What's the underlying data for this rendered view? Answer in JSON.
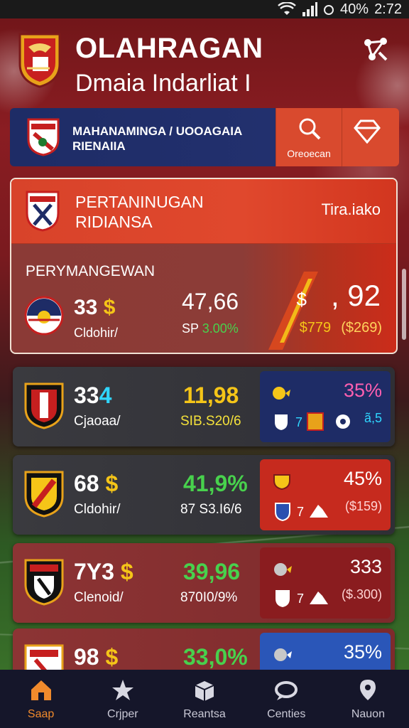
{
  "status_bar": {
    "battery": "40%",
    "time": "2:72"
  },
  "header": {
    "title": "OLAHRAGAN",
    "subtitle": "Dmaia Indarliat I"
  },
  "banner": {
    "line1": "MAHANAMINGA / UOOAGAIA",
    "line2": "RIENAIIA",
    "search_label": "Oreoecan"
  },
  "featured": {
    "title_line1": "PERTANINUGAN",
    "title_line2": "RIDIANSA",
    "tag": "Tira.iako",
    "section_label": "PERYMANGEWAN",
    "score": "33",
    "score_currency": "$",
    "label": "Cldohir/",
    "mid_value": "47,66",
    "mid_sub_prefix": "SP",
    "mid_sub_pct": "3.00%",
    "right_currency": "$",
    "right_value": ", 92",
    "right_sub_a": "$779",
    "right_sub_b": "($269)"
  },
  "cards": [
    {
      "score": "33",
      "score_suffix": "4",
      "label": "Cjaoaa/",
      "mid_value": "11,98",
      "mid_sub": "SIB.S20/6",
      "side_value": "35%",
      "side_num": "7",
      "side_sub": "ã,5"
    },
    {
      "score": "68",
      "score_currency": "$",
      "label": "Cldohir/",
      "mid_value": "41,9%",
      "mid_sub": "87 S3.I6/6",
      "side_value": "45%",
      "side_num": "7",
      "side_sub": "($159)"
    },
    {
      "score": "7Y3",
      "score_currency": "$",
      "label": "Clenoid/",
      "mid_value": "39,96",
      "mid_sub": "870I0/9%",
      "side_value": "333",
      "side_num": "7",
      "side_sub": "($.300)"
    },
    {
      "score": "98",
      "score_currency": "$",
      "label": "",
      "mid_value": "33,0%",
      "mid_sub": "",
      "side_value": "35%"
    }
  ],
  "colors": {
    "accent_orange": "#d94a2e",
    "navy": "#1e2c66",
    "gold": "#f5c518",
    "green": "#48d14d",
    "cyan": "#2fd6ff",
    "pink": "#ff5fb0",
    "nav_active": "#f08a2c"
  },
  "bottom_nav": [
    {
      "label": "Saap",
      "icon": "home-icon"
    },
    {
      "label": "Crjper",
      "icon": "star-icon"
    },
    {
      "label": "Reantsa",
      "icon": "box-icon"
    },
    {
      "label": "Centies",
      "icon": "chat-icon"
    },
    {
      "label": "Nauon",
      "icon": "pin-icon"
    }
  ]
}
